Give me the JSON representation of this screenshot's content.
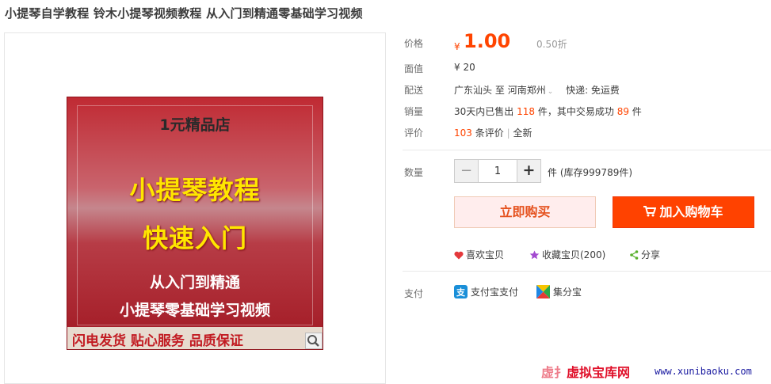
{
  "title": "小提琴自学教程 铃木小提琴视频教程 从入门到精通零基础学习视频",
  "product_image": {
    "shop_line": "1元精品店",
    "headline_1": "小提琴教程",
    "headline_2": "快速入门",
    "subline_1": "从入门到精通",
    "subline_2": "小提琴零基础学习视频",
    "bottom_band": "闪电发货 贴心服务 品质保证",
    "zoom_icon": "magnifier-icon"
  },
  "price": {
    "label": "价格",
    "currency": "¥",
    "value": "1.00",
    "discount": "0.50折"
  },
  "face_value": {
    "label": "面值",
    "value": "¥ 20"
  },
  "shipping": {
    "label": "配送",
    "from": "广东汕头",
    "to_word": "至",
    "destination": "河南郑州",
    "express": "快递: 免运费"
  },
  "sales": {
    "label": "销量",
    "prefix": "30天内已售出",
    "sold": "118",
    "mid": "件，其中交易成功",
    "success": "89",
    "suffix": "件"
  },
  "reviews": {
    "label": "评价",
    "count": "103",
    "unit": "条评价",
    "sep": "|",
    "new": "全新"
  },
  "quantity": {
    "label": "数量",
    "minus": "−",
    "plus": "+",
    "value": "1",
    "unit": "件",
    "stock": "(库存999789件)"
  },
  "buttons": {
    "buy_now": "立即购买",
    "add_to_cart": "加入购物车"
  },
  "actions": {
    "like": "喜欢宝贝",
    "favorite": "收藏宝贝(200)",
    "share": "分享"
  },
  "payment": {
    "label": "支付",
    "alipay": "支付宝支付",
    "jifenbao": "集分宝"
  },
  "watermark": {
    "text": "虚拟宝库网",
    "ghost": "虚扌",
    "url": "www.xunibaoku.com"
  },
  "colors": {
    "accent": "#ff4400",
    "buy_bg": "#ffeded",
    "cart_bg": "#ff4200"
  }
}
